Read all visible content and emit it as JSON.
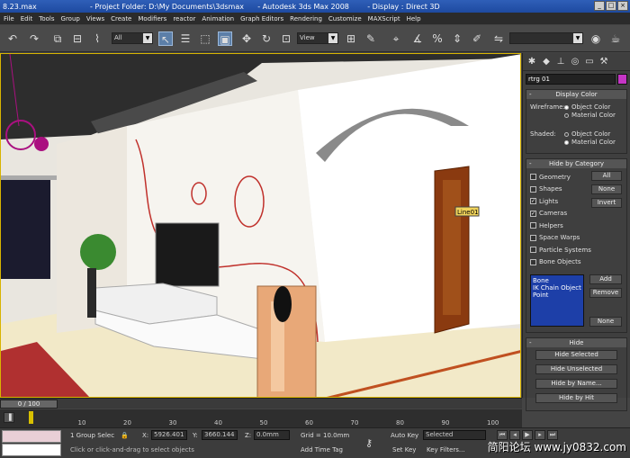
{
  "window": {
    "file_title": "8.23.max",
    "title_text": "- Project Folder: D:\\My Documents\\3dsmax      - Autodesk 3ds Max 2008        - Display : Direct 3D"
  },
  "menu": [
    "File",
    "Edit",
    "Tools",
    "Group",
    "Views",
    "Create",
    "Modifiers",
    "reactor",
    "Animation",
    "Graph Editors",
    "Rendering",
    "Customize",
    "MAXScript",
    "Help"
  ],
  "toolbar": {
    "selection_filter": "All",
    "reference_coord": "View"
  },
  "viewport": {
    "label": "Line01"
  },
  "command_panel": {
    "object_name": "rtrg 01",
    "object_color": "#c535c5",
    "display_color": {
      "title": "Display Color",
      "wireframe_label": "Wireframe:",
      "shaded_label": "Shaded:",
      "opt_object": "Object Color",
      "opt_material": "Material Color"
    },
    "hide_by_category": {
      "title": "Hide by Category",
      "items": [
        {
          "label": "Geometry",
          "checked": false
        },
        {
          "label": "Shapes",
          "checked": false
        },
        {
          "label": "Lights",
          "checked": true
        },
        {
          "label": "Cameras",
          "checked": true
        },
        {
          "label": "Helpers",
          "checked": false
        },
        {
          "label": "Space Warps",
          "checked": false
        },
        {
          "label": "Particle Systems",
          "checked": false
        },
        {
          "label": "Bone Objects",
          "checked": false
        }
      ],
      "btn_all": "All",
      "btn_none": "None",
      "btn_invert": "Invert",
      "list_items": [
        "Bone",
        "IK Chain Object",
        "Point"
      ],
      "btn_add": "Add",
      "btn_remove": "Remove",
      "btn_none2": "None"
    },
    "hide": {
      "title": "Hide",
      "buttons": [
        "Hide Selected",
        "Hide Unselected",
        "Hide by Name...",
        "Hide by Hit"
      ]
    }
  },
  "timeline": {
    "slider_text": "0 / 100",
    "ticks": [
      "10",
      "20",
      "30",
      "40",
      "50",
      "60",
      "70",
      "80",
      "90",
      "100"
    ]
  },
  "status": {
    "selection": "1 Group Selec",
    "x_label": "X:",
    "x_value": "5926.401",
    "y_label": "Y:",
    "y_value": "3660.144",
    "z_label": "Z:",
    "z_value": "0.0mm",
    "grid": "Grid = 10.0mm",
    "auto_key": "Auto Key",
    "key_mode": "Selected",
    "set_key": "Set Key",
    "key_filters": "Key Filters...",
    "prompt": "Click or click-and-drag to select objects",
    "add_time_tag": "Add Time Tag"
  },
  "watermark": "简阳论坛  www.jy0832.com"
}
